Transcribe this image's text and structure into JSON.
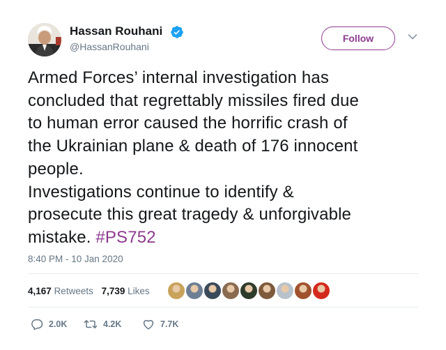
{
  "author": {
    "name": "Hassan Rouhani",
    "handle": "@HassanRouhani",
    "verified": true,
    "avatar_icon": "profile-photo"
  },
  "follow_button": {
    "label": "Follow",
    "color": "#8c3a8f"
  },
  "tweet": {
    "lines": [
      "Armed Forces’ internal investigation has",
      "concluded that regrettably missiles fired due",
      "to human error caused the horrific crash of",
      "the Ukrainian plane & death of 176 innocent",
      "people.",
      "Investigations continue to identify &",
      "prosecute this great tragedy & unforgivable",
      "mistake."
    ],
    "hashtag": "#PS752",
    "timestamp": "8:40 PM - 10 Jan 2020"
  },
  "stats": {
    "retweets_count": "4,167",
    "retweets_label": "Retweets",
    "likes_count": "7,739",
    "likes_label": "Likes"
  },
  "likers": [
    {
      "icon": "avatar",
      "color": "#c9a25b"
    },
    {
      "icon": "avatar",
      "color": "#6d7f94"
    },
    {
      "icon": "avatar",
      "color": "#3a4a5a"
    },
    {
      "icon": "avatar",
      "color": "#8a6b4f"
    },
    {
      "icon": "avatar",
      "color": "#2f3b2a"
    },
    {
      "icon": "avatar",
      "color": "#7d5a3c"
    },
    {
      "icon": "avatar",
      "color": "#b8c2cc"
    },
    {
      "icon": "avatar",
      "color": "#a0522d"
    },
    {
      "icon": "avatar",
      "color": "#d42a1e"
    }
  ],
  "actions": {
    "replies": "2.0K",
    "retweets": "4.2K",
    "likes": "7.7K"
  },
  "colors": {
    "text": "#14171a",
    "secondary": "#657786",
    "accent": "#8c3a8f",
    "verified": "#1da1f2",
    "divider": "#e6ecf0"
  }
}
